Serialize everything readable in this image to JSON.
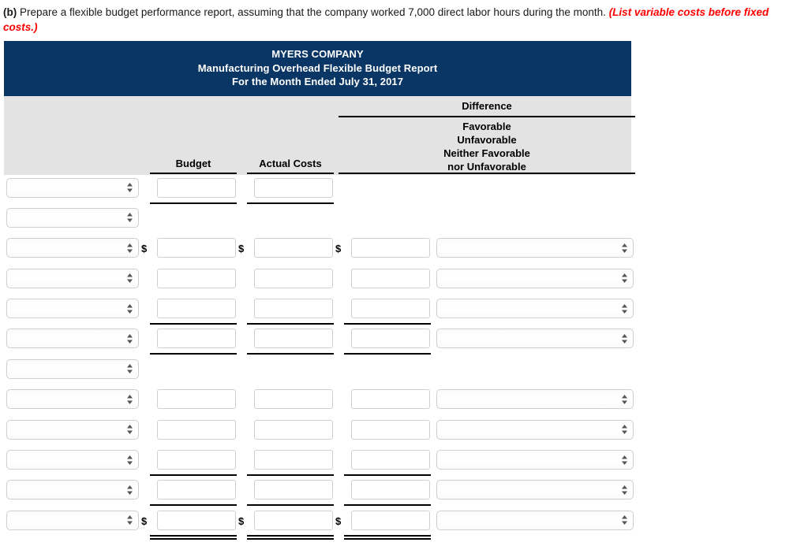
{
  "question": {
    "label": "(b)",
    "text": " Prepare a flexible budget performance report, assuming that the company worked 7,000 direct labor hours during the month. ",
    "emphasis": "(List variable costs before fixed costs.)"
  },
  "report": {
    "company": "MYERS COMPANY",
    "report_title": "Manufacturing Overhead Flexible Budget Report",
    "period": "For the Month Ended July 31, 2017",
    "columns": {
      "budget": "Budget",
      "actual_costs": "Actual Costs",
      "difference": "Difference",
      "difference_sub_line1": "Favorable",
      "difference_sub_line2": "Unfavorable",
      "difference_sub_line3": "Neither Favorable",
      "difference_sub_line4": "nor Unfavorable"
    }
  },
  "colors": {
    "header_band": "#0a3665",
    "column_head_band": "#e3e3e3",
    "emphasis_text": "#ff0000",
    "rule": "#000000",
    "field_border": "#cfcfcf"
  },
  "currency_symbol": "$",
  "field_placeholder": "",
  "rows": [
    {
      "index": 1,
      "select_value": "",
      "budget": {
        "present": true,
        "value": "",
        "dollar": false,
        "rule": "single"
      },
      "actual": {
        "present": true,
        "value": "",
        "dollar": false,
        "rule": "single"
      },
      "difference": {
        "present": false,
        "value": "",
        "dollar": false,
        "rule": "none"
      },
      "dropdown": {
        "present": false,
        "value": ""
      }
    },
    {
      "index": 2,
      "select_value": "",
      "budget": {
        "present": false,
        "value": "",
        "dollar": false,
        "rule": "none"
      },
      "actual": {
        "present": false,
        "value": "",
        "dollar": false,
        "rule": "none"
      },
      "difference": {
        "present": false,
        "value": "",
        "dollar": false,
        "rule": "none"
      },
      "dropdown": {
        "present": false,
        "value": ""
      }
    },
    {
      "index": 3,
      "select_value": "",
      "budget": {
        "present": true,
        "value": "",
        "dollar": true,
        "rule": "none"
      },
      "actual": {
        "present": true,
        "value": "",
        "dollar": true,
        "rule": "none"
      },
      "difference": {
        "present": true,
        "value": "",
        "dollar": true,
        "rule": "none"
      },
      "dropdown": {
        "present": true,
        "value": ""
      }
    },
    {
      "index": 4,
      "select_value": "",
      "budget": {
        "present": true,
        "value": "",
        "dollar": false,
        "rule": "none"
      },
      "actual": {
        "present": true,
        "value": "",
        "dollar": false,
        "rule": "none"
      },
      "difference": {
        "present": true,
        "value": "",
        "dollar": false,
        "rule": "none"
      },
      "dropdown": {
        "present": true,
        "value": ""
      }
    },
    {
      "index": 5,
      "select_value": "",
      "budget": {
        "present": true,
        "value": "",
        "dollar": false,
        "rule": "single"
      },
      "actual": {
        "present": true,
        "value": "",
        "dollar": false,
        "rule": "single"
      },
      "difference": {
        "present": true,
        "value": "",
        "dollar": false,
        "rule": "single"
      },
      "dropdown": {
        "present": true,
        "value": ""
      }
    },
    {
      "index": 6,
      "select_value": "",
      "budget": {
        "present": true,
        "value": "",
        "dollar": false,
        "rule": "single"
      },
      "actual": {
        "present": true,
        "value": "",
        "dollar": false,
        "rule": "single"
      },
      "difference": {
        "present": true,
        "value": "",
        "dollar": false,
        "rule": "single"
      },
      "dropdown": {
        "present": true,
        "value": ""
      }
    },
    {
      "index": 7,
      "select_value": "",
      "budget": {
        "present": false,
        "value": "",
        "dollar": false,
        "rule": "none"
      },
      "actual": {
        "present": false,
        "value": "",
        "dollar": false,
        "rule": "none"
      },
      "difference": {
        "present": false,
        "value": "",
        "dollar": false,
        "rule": "none"
      },
      "dropdown": {
        "present": false,
        "value": ""
      }
    },
    {
      "index": 8,
      "select_value": "",
      "budget": {
        "present": true,
        "value": "",
        "dollar": false,
        "rule": "none"
      },
      "actual": {
        "present": true,
        "value": "",
        "dollar": false,
        "rule": "none"
      },
      "difference": {
        "present": true,
        "value": "",
        "dollar": false,
        "rule": "none"
      },
      "dropdown": {
        "present": true,
        "value": ""
      }
    },
    {
      "index": 9,
      "select_value": "",
      "budget": {
        "present": true,
        "value": "",
        "dollar": false,
        "rule": "none"
      },
      "actual": {
        "present": true,
        "value": "",
        "dollar": false,
        "rule": "none"
      },
      "difference": {
        "present": true,
        "value": "",
        "dollar": false,
        "rule": "none"
      },
      "dropdown": {
        "present": true,
        "value": ""
      }
    },
    {
      "index": 10,
      "select_value": "",
      "budget": {
        "present": true,
        "value": "",
        "dollar": false,
        "rule": "single"
      },
      "actual": {
        "present": true,
        "value": "",
        "dollar": false,
        "rule": "single"
      },
      "difference": {
        "present": true,
        "value": "",
        "dollar": false,
        "rule": "single"
      },
      "dropdown": {
        "present": true,
        "value": ""
      }
    },
    {
      "index": 11,
      "select_value": "",
      "budget": {
        "present": true,
        "value": "",
        "dollar": false,
        "rule": "single"
      },
      "actual": {
        "present": true,
        "value": "",
        "dollar": false,
        "rule": "single"
      },
      "difference": {
        "present": true,
        "value": "",
        "dollar": false,
        "rule": "single"
      },
      "dropdown": {
        "present": true,
        "value": ""
      }
    },
    {
      "index": 12,
      "select_value": "",
      "budget": {
        "present": true,
        "value": "",
        "dollar": true,
        "rule": "double"
      },
      "actual": {
        "present": true,
        "value": "",
        "dollar": true,
        "rule": "double"
      },
      "difference": {
        "present": true,
        "value": "",
        "dollar": true,
        "rule": "double"
      },
      "dropdown": {
        "present": true,
        "value": ""
      }
    }
  ]
}
